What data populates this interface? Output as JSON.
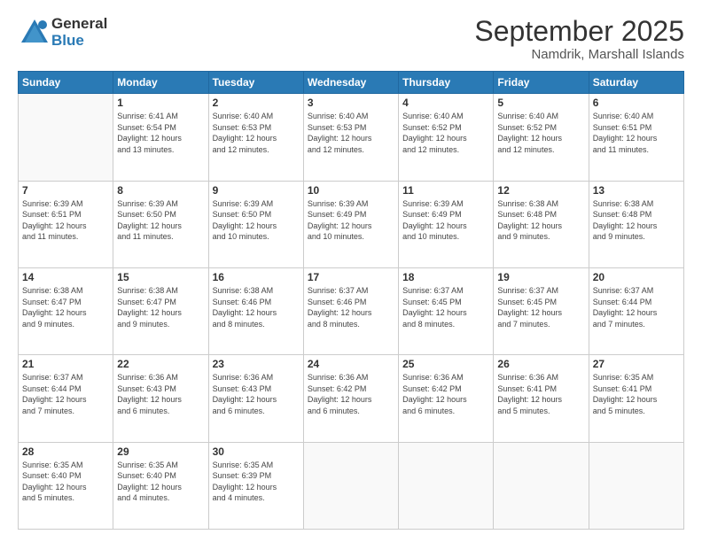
{
  "logo": {
    "general": "General",
    "blue": "Blue"
  },
  "title": "September 2025",
  "location": "Namdrik, Marshall Islands",
  "days_header": [
    "Sunday",
    "Monday",
    "Tuesday",
    "Wednesday",
    "Thursday",
    "Friday",
    "Saturday"
  ],
  "weeks": [
    [
      {
        "num": "",
        "info": ""
      },
      {
        "num": "1",
        "info": "Sunrise: 6:41 AM\nSunset: 6:54 PM\nDaylight: 12 hours\nand 13 minutes."
      },
      {
        "num": "2",
        "info": "Sunrise: 6:40 AM\nSunset: 6:53 PM\nDaylight: 12 hours\nand 12 minutes."
      },
      {
        "num": "3",
        "info": "Sunrise: 6:40 AM\nSunset: 6:53 PM\nDaylight: 12 hours\nand 12 minutes."
      },
      {
        "num": "4",
        "info": "Sunrise: 6:40 AM\nSunset: 6:52 PM\nDaylight: 12 hours\nand 12 minutes."
      },
      {
        "num": "5",
        "info": "Sunrise: 6:40 AM\nSunset: 6:52 PM\nDaylight: 12 hours\nand 12 minutes."
      },
      {
        "num": "6",
        "info": "Sunrise: 6:40 AM\nSunset: 6:51 PM\nDaylight: 12 hours\nand 11 minutes."
      }
    ],
    [
      {
        "num": "7",
        "info": "Sunrise: 6:39 AM\nSunset: 6:51 PM\nDaylight: 12 hours\nand 11 minutes."
      },
      {
        "num": "8",
        "info": "Sunrise: 6:39 AM\nSunset: 6:50 PM\nDaylight: 12 hours\nand 11 minutes."
      },
      {
        "num": "9",
        "info": "Sunrise: 6:39 AM\nSunset: 6:50 PM\nDaylight: 12 hours\nand 10 minutes."
      },
      {
        "num": "10",
        "info": "Sunrise: 6:39 AM\nSunset: 6:49 PM\nDaylight: 12 hours\nand 10 minutes."
      },
      {
        "num": "11",
        "info": "Sunrise: 6:39 AM\nSunset: 6:49 PM\nDaylight: 12 hours\nand 10 minutes."
      },
      {
        "num": "12",
        "info": "Sunrise: 6:38 AM\nSunset: 6:48 PM\nDaylight: 12 hours\nand 9 minutes."
      },
      {
        "num": "13",
        "info": "Sunrise: 6:38 AM\nSunset: 6:48 PM\nDaylight: 12 hours\nand 9 minutes."
      }
    ],
    [
      {
        "num": "14",
        "info": "Sunrise: 6:38 AM\nSunset: 6:47 PM\nDaylight: 12 hours\nand 9 minutes."
      },
      {
        "num": "15",
        "info": "Sunrise: 6:38 AM\nSunset: 6:47 PM\nDaylight: 12 hours\nand 9 minutes."
      },
      {
        "num": "16",
        "info": "Sunrise: 6:38 AM\nSunset: 6:46 PM\nDaylight: 12 hours\nand 8 minutes."
      },
      {
        "num": "17",
        "info": "Sunrise: 6:37 AM\nSunset: 6:46 PM\nDaylight: 12 hours\nand 8 minutes."
      },
      {
        "num": "18",
        "info": "Sunrise: 6:37 AM\nSunset: 6:45 PM\nDaylight: 12 hours\nand 8 minutes."
      },
      {
        "num": "19",
        "info": "Sunrise: 6:37 AM\nSunset: 6:45 PM\nDaylight: 12 hours\nand 7 minutes."
      },
      {
        "num": "20",
        "info": "Sunrise: 6:37 AM\nSunset: 6:44 PM\nDaylight: 12 hours\nand 7 minutes."
      }
    ],
    [
      {
        "num": "21",
        "info": "Sunrise: 6:37 AM\nSunset: 6:44 PM\nDaylight: 12 hours\nand 7 minutes."
      },
      {
        "num": "22",
        "info": "Sunrise: 6:36 AM\nSunset: 6:43 PM\nDaylight: 12 hours\nand 6 minutes."
      },
      {
        "num": "23",
        "info": "Sunrise: 6:36 AM\nSunset: 6:43 PM\nDaylight: 12 hours\nand 6 minutes."
      },
      {
        "num": "24",
        "info": "Sunrise: 6:36 AM\nSunset: 6:42 PM\nDaylight: 12 hours\nand 6 minutes."
      },
      {
        "num": "25",
        "info": "Sunrise: 6:36 AM\nSunset: 6:42 PM\nDaylight: 12 hours\nand 6 minutes."
      },
      {
        "num": "26",
        "info": "Sunrise: 6:36 AM\nSunset: 6:41 PM\nDaylight: 12 hours\nand 5 minutes."
      },
      {
        "num": "27",
        "info": "Sunrise: 6:35 AM\nSunset: 6:41 PM\nDaylight: 12 hours\nand 5 minutes."
      }
    ],
    [
      {
        "num": "28",
        "info": "Sunrise: 6:35 AM\nSunset: 6:40 PM\nDaylight: 12 hours\nand 5 minutes."
      },
      {
        "num": "29",
        "info": "Sunrise: 6:35 AM\nSunset: 6:40 PM\nDaylight: 12 hours\nand 4 minutes."
      },
      {
        "num": "30",
        "info": "Sunrise: 6:35 AM\nSunset: 6:39 PM\nDaylight: 12 hours\nand 4 minutes."
      },
      {
        "num": "",
        "info": ""
      },
      {
        "num": "",
        "info": ""
      },
      {
        "num": "",
        "info": ""
      },
      {
        "num": "",
        "info": ""
      }
    ]
  ]
}
